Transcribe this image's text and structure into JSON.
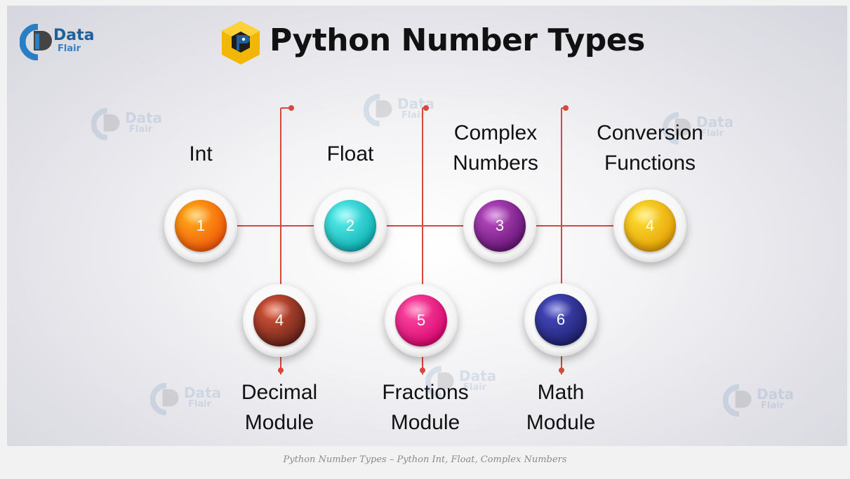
{
  "title": "Python Number Types",
  "brand": {
    "line1": "Data",
    "line2": "Flair"
  },
  "top_items": [
    {
      "number": "1",
      "lines": [
        "Int"
      ],
      "color_light": "#ffb11a",
      "color_dark": "#f04e08"
    },
    {
      "number": "2",
      "lines": [
        "Float"
      ],
      "color_light": "#5ff3f0",
      "color_dark": "#06a9ad"
    },
    {
      "number": "3",
      "lines": [
        "Complex",
        "Numbers"
      ],
      "color_light": "#c04fc9",
      "color_dark": "#5c0f6c"
    },
    {
      "number": "4",
      "lines": [
        "Conversion",
        "Functions"
      ],
      "color_light": "#ffe234",
      "color_dark": "#e29a00"
    }
  ],
  "bottom_items": [
    {
      "number": "4",
      "lines": [
        "Decimal",
        "Module"
      ],
      "color_light": "#e0593b",
      "color_dark": "#5a1d16"
    },
    {
      "number": "5",
      "lines": [
        "Fractions",
        "Module"
      ],
      "color_light": "#ff4fa6",
      "color_dark": "#d4006a"
    },
    {
      "number": "6",
      "lines": [
        "Math",
        "Module"
      ],
      "color_light": "#4b4fc8",
      "color_dark": "#1b1c66"
    }
  ],
  "connector_color": "#d8473c",
  "caption": "Python Number Types – Python Int, Float, Complex Numbers"
}
